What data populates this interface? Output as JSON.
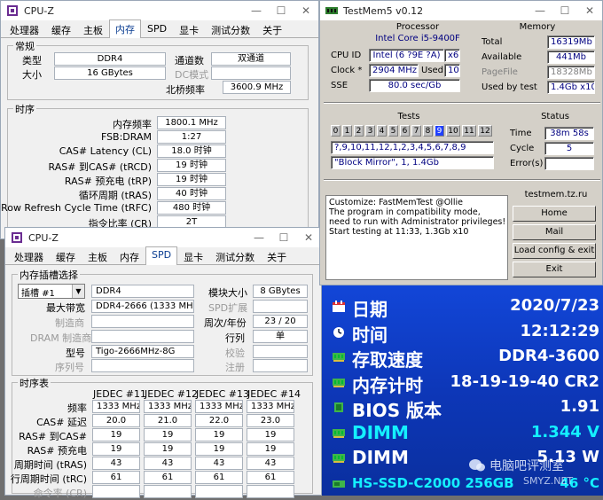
{
  "cpuz_top": {
    "title": "CPU-Z",
    "tabs": [
      "处理器",
      "缓存",
      "主板",
      "内存",
      "SPD",
      "显卡",
      "测试分数",
      "关于"
    ],
    "active_tab": "内存",
    "general": {
      "heading": "常规",
      "type_label": "类型",
      "type_value": "DDR4",
      "size_label": "大小",
      "size_value": "16 GBytes",
      "channels_label": "通道数",
      "channels_value": "双通道",
      "dc_label": "DC模式",
      "dc_value": "",
      "nb_label": "北桥频率",
      "nb_value": "3600.9 MHz"
    },
    "timings": {
      "heading": "时序",
      "rows": [
        {
          "label": "内存频率",
          "value": "1800.1 MHz"
        },
        {
          "label": "FSB:DRAM",
          "value": "1:27"
        },
        {
          "label": "CAS# Latency (CL)",
          "value": "18.0 时钟"
        },
        {
          "label": "RAS# 到CAS# (tRCD)",
          "value": "19 时钟"
        },
        {
          "label": "RAS# 预充电 (tRP)",
          "value": "19 时钟"
        },
        {
          "label": "循环周期 (tRAS)",
          "value": "40 时钟"
        },
        {
          "label": "Row Refresh Cycle Time (tRFC)",
          "value": "480 时钟"
        },
        {
          "label": "指令比率 (CR)",
          "value": "2T"
        }
      ]
    }
  },
  "cpuz_spd": {
    "title": "CPU-Z",
    "tabs": [
      "处理器",
      "缓存",
      "主板",
      "内存",
      "SPD",
      "显卡",
      "测试分数",
      "关于"
    ],
    "active_tab": "SPD",
    "slot": {
      "heading": "内存插槽选择",
      "slot_value": "插槽 #1",
      "type_value": "DDR4",
      "module_size_label": "模块大小",
      "module_size_value": "8 GBytes",
      "bandwidth_label": "最大带宽",
      "bandwidth_value": "DDR4-2666 (1333 MHz)",
      "spd_ext_label": "SPD扩展",
      "manufacturer_label": "制造商",
      "week_year_label": "周次/年份",
      "week_year_value": "23 / 20",
      "dram_mfr_label": "DRAM 制造商",
      "rank_label": "行列",
      "rank_value": "单",
      "part_label": "型号",
      "part_value": "Tigo-2666MHz-8G",
      "check_label": "校验",
      "serial_label": "序列号",
      "reg_label": "注册"
    },
    "timing_table": {
      "heading": "时序表",
      "columns": [
        "JEDEC #11",
        "JEDEC #12",
        "JEDEC #13",
        "JEDEC #14"
      ],
      "rows": [
        {
          "label": "频率",
          "values": [
            "1333 MHz",
            "1333 MHz",
            "1333 MHz",
            "1333 MHz"
          ]
        },
        {
          "label": "CAS# 延迟",
          "values": [
            "20.0",
            "21.0",
            "22.0",
            "23.0"
          ]
        },
        {
          "label": "RAS# 到CAS#",
          "values": [
            "19",
            "19",
            "19",
            "19"
          ]
        },
        {
          "label": "RAS# 预充电",
          "values": [
            "19",
            "19",
            "19",
            "19"
          ]
        },
        {
          "label": "周期时间 (tRAS)",
          "values": [
            "43",
            "43",
            "43",
            "43"
          ]
        },
        {
          "label": "行周期时间 (tRC)",
          "values": [
            "61",
            "61",
            "61",
            "61"
          ]
        },
        {
          "label": "命令率 (CR)",
          "values": [
            "",
            "",
            "",
            ""
          ]
        }
      ]
    }
  },
  "testmem": {
    "title": "TestMem5 v0.12",
    "processor_heading": "Processor",
    "cpu_name": "Intel Core i5-9400F",
    "cpu_id_label": "CPU ID",
    "cpu_id_value": "Intel (6 ?9E ?A)",
    "cpu_threads": "x6",
    "clock_label": "Clock *",
    "clock_value": "2904 MHz",
    "used_label": "Used",
    "used_value": "10",
    "sse_label": "SSE",
    "sse_value": "80.0 sec/Gb",
    "memory_heading": "Memory",
    "total_label": "Total",
    "total_value": "16319Mb",
    "available_label": "Available",
    "available_value": "441Mb",
    "pagefile_label": "PageFile",
    "pagefile_value": "18328Mb",
    "usedbytest_label": "Used by test",
    "usedbytest_value": "1.4Gb x10",
    "tests_heading": "Tests",
    "test_cells": [
      "0",
      "1",
      "2",
      "3",
      "4",
      "5",
      "6",
      "7",
      "8",
      "9",
      "10",
      "11",
      "12"
    ],
    "active_test": "9",
    "test_sequence": "?,9,10,11,12,1,2,3,4,5,6,7,8,9",
    "test_mode": "\"Block Mirror\", 1, 1.4Gb",
    "status_heading": "Status",
    "time_label": "Time",
    "time_value": "38m 58s",
    "cycle_label": "Cycle",
    "cycle_value": "5",
    "errors_label": "Error(s)",
    "errors_value": "",
    "log_text": "Customize: FastMemTest @Ollie\nThe program in compatibility mode,\nneed to run with Administrator privileges!\nStart testing at 11:33, 1.3Gb x10",
    "site": "testmem.tz.ru",
    "buttons": [
      "Home",
      "Mail",
      "Load config & exit",
      "Exit"
    ]
  },
  "sensor_panel": {
    "rows": [
      {
        "icon": "calendar-icon",
        "label": "日期",
        "value": "2020/7/23"
      },
      {
        "icon": "clock-icon",
        "label": "时间",
        "value": "12:12:29"
      },
      {
        "icon": "memory-icon",
        "label": "存取速度",
        "value": "DDR4-3600"
      },
      {
        "icon": "memory-icon",
        "label": "内存计时",
        "value": "18-19-19-40 CR2"
      },
      {
        "icon": "chip-icon",
        "label": "BIOS 版本",
        "value": "1.91"
      },
      {
        "icon": "memory-icon",
        "label": "DIMM",
        "value": "1.344 V"
      },
      {
        "icon": "memory-icon",
        "label": "DIMM",
        "value": "5.13 W"
      },
      {
        "icon": "disk-icon",
        "label": "HS-SSD-C2000 256GB",
        "value": "46 °C"
      }
    ],
    "watermark": "电脑吧评测室",
    "watermark2": "SMYZ.NET"
  },
  "colors": {
    "panel_blue": "#1246d8",
    "cyan_value": "#14f0ff",
    "testmem_bg": "#d4d0c8",
    "active_cell": "#2040ff"
  }
}
